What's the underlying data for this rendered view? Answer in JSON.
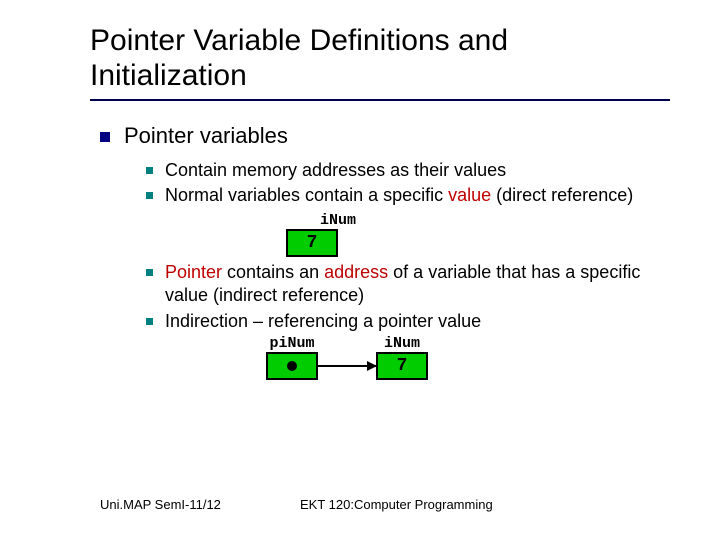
{
  "title": "Pointer Variable Definitions and Initialization",
  "lvl1": {
    "text": "Pointer variables"
  },
  "b1": {
    "text": "Contain memory addresses as their values"
  },
  "b2": {
    "pre": "Normal variables",
    "mid": " contain a specific ",
    "red": "value",
    "post": " (direct reference)"
  },
  "diag1": {
    "label": "iNum",
    "value": "7"
  },
  "b3": {
    "red1": "Pointer",
    "mid1": " contains an ",
    "red2": "address",
    "post": " of a variable that has a specific value (indirect reference)"
  },
  "b4": {
    "text": "Indirection – referencing a pointer value"
  },
  "diag2": {
    "ptr_label": "piNum",
    "val_label": "iNum",
    "value": "7"
  },
  "footer": {
    "left": "Uni.MAP SemI-11/12",
    "right": "EKT 120:Computer Programming"
  }
}
